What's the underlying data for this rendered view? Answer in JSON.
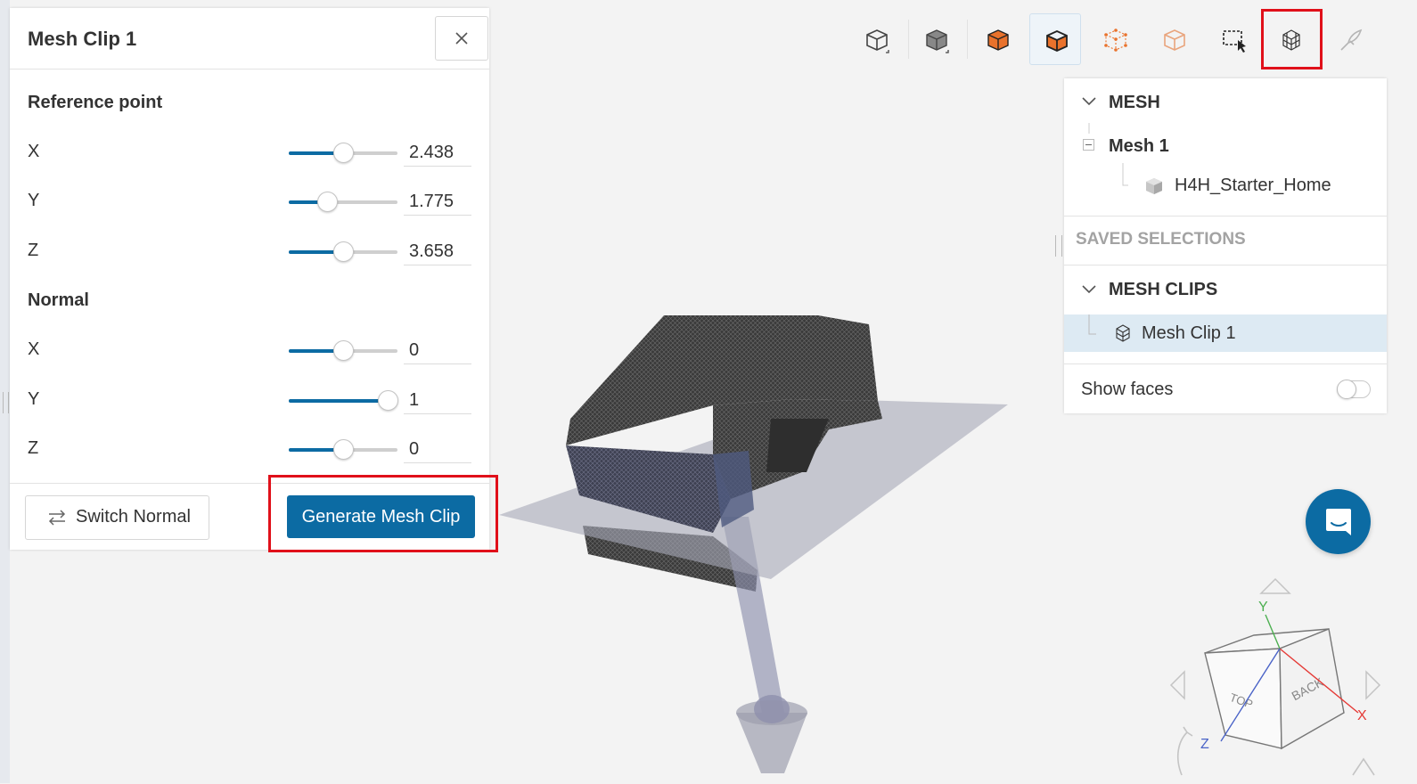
{
  "panel": {
    "title": "Mesh Clip 1",
    "reference_point_label": "Reference point",
    "normal_label": "Normal",
    "reference_point": [
      {
        "axis": "X",
        "value": "2.438",
        "slider_fraction": 0.5
      },
      {
        "axis": "Y",
        "value": "1.775",
        "slider_fraction": 0.35
      },
      {
        "axis": "Z",
        "value": "3.658",
        "slider_fraction": 0.5
      }
    ],
    "normal": [
      {
        "axis": "X",
        "value": "0",
        "slider_fraction": 0.5
      },
      {
        "axis": "Y",
        "value": "1",
        "slider_fraction": 0.91
      },
      {
        "axis": "Z",
        "value": "0",
        "slider_fraction": 0.5
      }
    ],
    "switch_normal_label": "Switch Normal",
    "generate_label": "Generate Mesh Clip"
  },
  "toolbar": {
    "buttons": [
      "surface-view-icon",
      "solid-view-icon",
      "filled-cube-icon",
      "selected-face-cube-icon",
      "wireframe-points-icon",
      "outline-cube-icon",
      "box-select-icon",
      "mesh-clip-icon",
      "paint-tool-icon"
    ],
    "highlighted": "mesh-clip-icon"
  },
  "tree": {
    "mesh_header": "MESH",
    "mesh_item": "Mesh 1",
    "geometry_item": "H4H_Starter_Home",
    "saved_selections": "SAVED SELECTIONS",
    "mesh_clips_header": "MESH CLIPS",
    "mesh_clip_item": "Mesh Clip 1",
    "show_faces_label": "Show faces",
    "show_faces_on": false
  },
  "navigator": {
    "top": "TOP",
    "back": "BACK",
    "axes": {
      "x": "X",
      "y": "Y",
      "z": "Z"
    }
  },
  "colors": {
    "accent": "#0c6ba3",
    "highlight_border": "#e0101a",
    "toolbar_orange": "#e9722c"
  }
}
